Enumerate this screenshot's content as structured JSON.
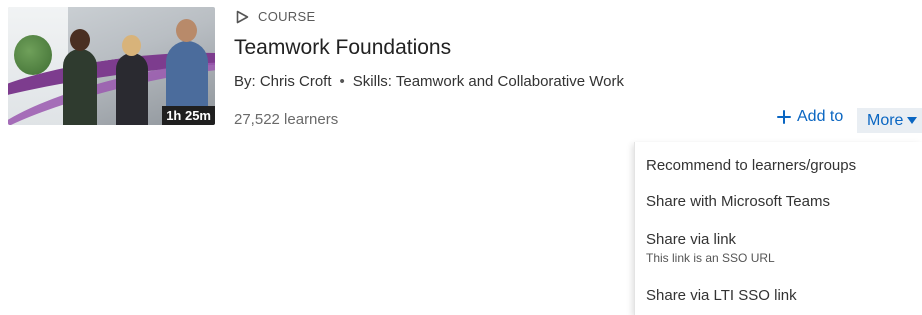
{
  "course": {
    "type_label": "COURSE",
    "title": "Teamwork Foundations",
    "author": "By: Chris Croft",
    "separator": "•",
    "skills": "Skills: Teamwork and Collaborative Work",
    "learners": "27,522 learners",
    "duration": "1h 25m"
  },
  "actions": {
    "add_to_label": "Add to",
    "more_label": "More"
  },
  "menu": {
    "items": [
      {
        "label": "Recommend to learners/groups"
      },
      {
        "label": "Share with Microsoft Teams"
      },
      {
        "label": "Share via link",
        "sublabel": "This link is an SSO URL"
      },
      {
        "label": "Share via LTI SSO link"
      }
    ]
  },
  "icons": {
    "type": "play-outline-icon",
    "add": "plus-icon",
    "more": "caret-down-icon"
  },
  "colors": {
    "accent": "#0a66c2",
    "more_bg": "#e9eef3",
    "duration_bg": "#1f1f1f"
  }
}
